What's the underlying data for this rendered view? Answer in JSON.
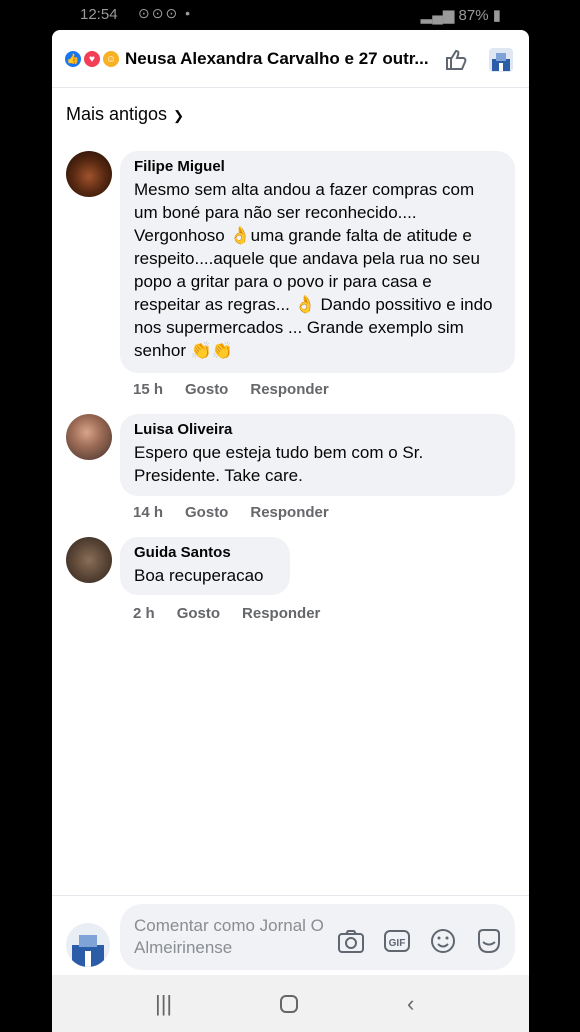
{
  "status_bar": {
    "time": "12:54",
    "battery": "87%"
  },
  "header": {
    "title": "Neusa Alexandra Carvalho e 27 outr..."
  },
  "sort": {
    "label": "Mais antigos"
  },
  "comments": [
    {
      "author": "Filipe Miguel",
      "text": "Mesmo sem alta andou a fazer compras com um boné para não ser reconhecido.... Vergonhoso 👌uma grande falta de atitude e respeito....aquele que andava pela rua no seu popo a gritar para o povo ir para casa e respeitar as regras... 👌 Dando possitivo e indo nos supermercados  ... Grande exemplo sim senhor 👏👏",
      "time": "15 h",
      "like": "Gosto",
      "reply": "Responder"
    },
    {
      "author": "Luisa Oliveira",
      "text": "Espero que esteja tudo bem com o Sr. Presidente. Take care.",
      "time": "14 h",
      "like": "Gosto",
      "reply": "Responder"
    },
    {
      "author": "Guida Santos",
      "text": "Boa recuperacao",
      "time": "2 h",
      "like": "Gosto",
      "reply": "Responder"
    }
  ],
  "composer": {
    "placeholder": "Comentar como Jornal O Almeirinense"
  },
  "icons": [
    "like-reaction-icon",
    "love-reaction-icon",
    "care-reaction-icon",
    "like-outline-icon",
    "page-avatar-icon",
    "camera-icon",
    "gif-icon",
    "emoji-icon",
    "sticker-icon"
  ]
}
